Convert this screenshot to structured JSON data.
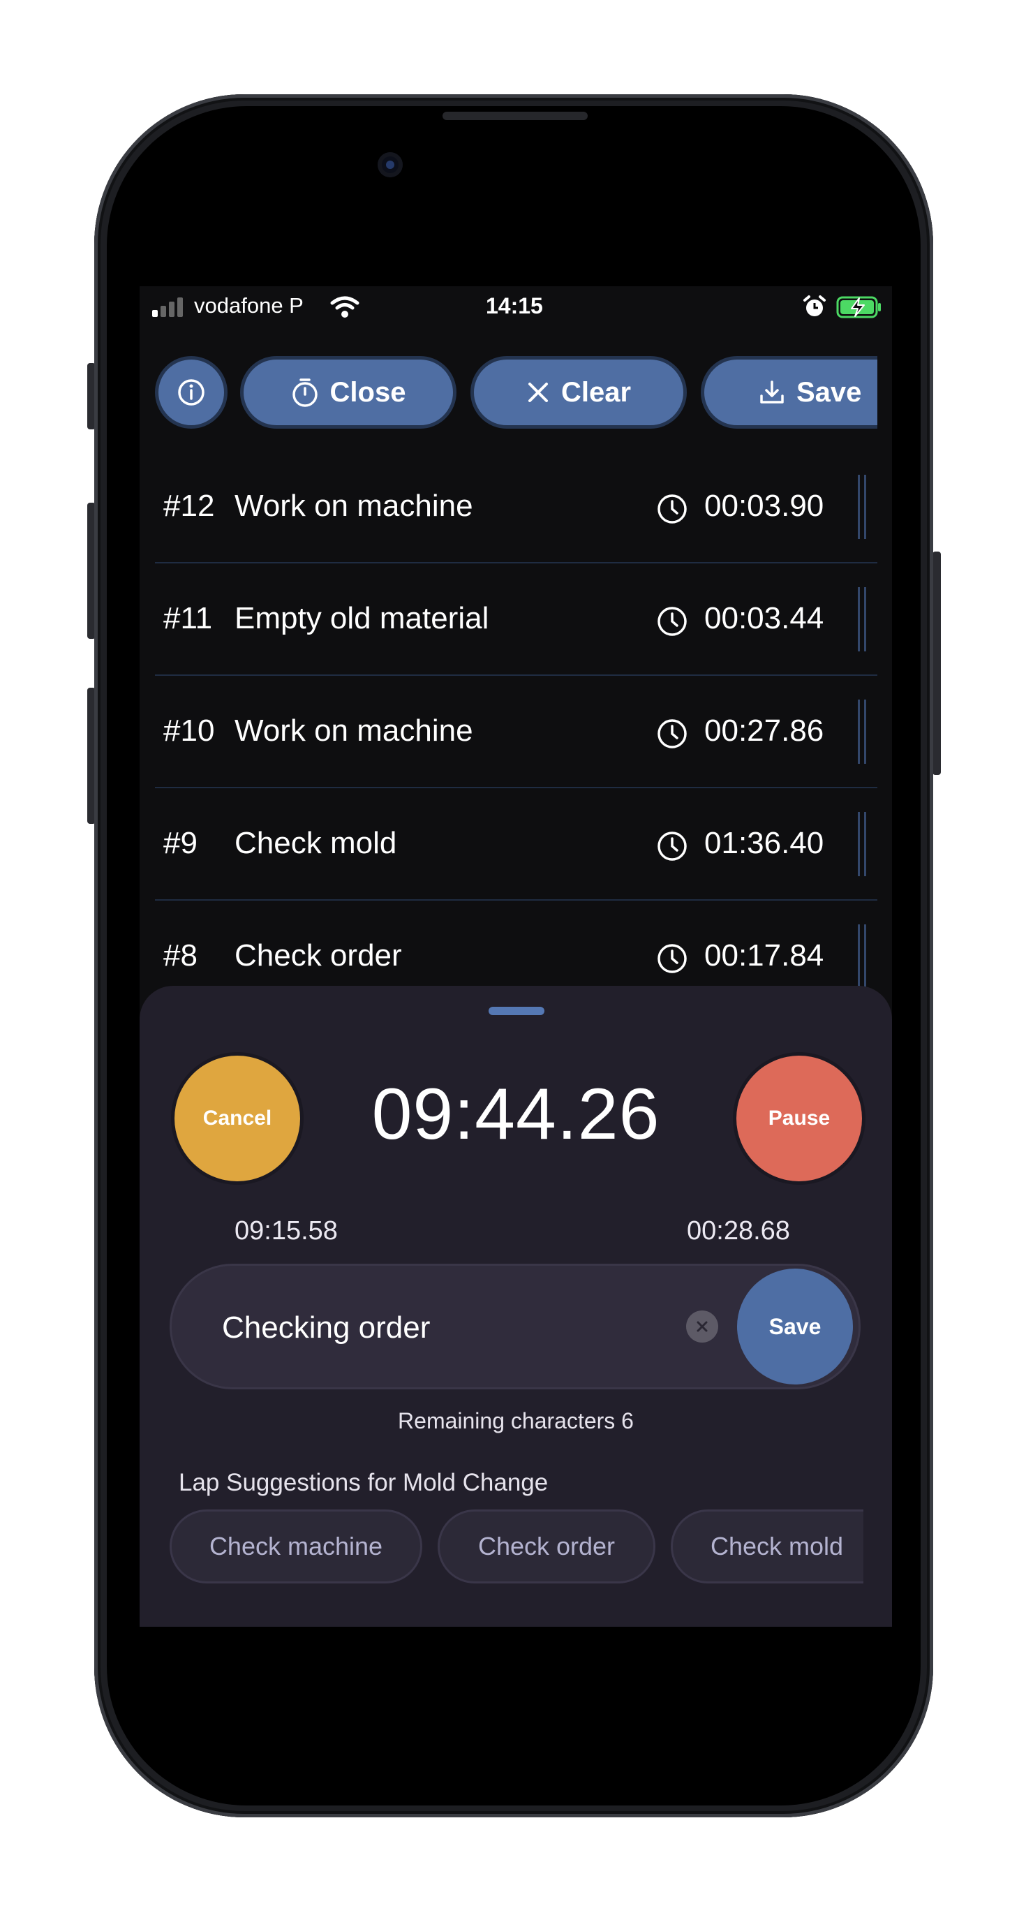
{
  "status_bar": {
    "carrier": "vodafone P",
    "time": "14:15",
    "signal_bars_filled": 1,
    "battery": "charging"
  },
  "toolbar": {
    "info_icon": "info-icon",
    "close_label": "Close",
    "clear_label": "Clear",
    "save_label": "Save"
  },
  "laps": [
    {
      "number": "#12",
      "name": "Work on machine",
      "time": "00:03.90"
    },
    {
      "number": "#11",
      "name": "Empty old material",
      "time": "00:03.44"
    },
    {
      "number": "#10",
      "name": "Work on machine",
      "time": "00:27.86"
    },
    {
      "number": "#9",
      "name": "Check mold",
      "time": "01:36.40"
    },
    {
      "number": "#8",
      "name": "Check order",
      "time": "00:17.84"
    }
  ],
  "timer": {
    "cancel_label": "Cancel",
    "pause_label": "Pause",
    "main_time": "09:44.26",
    "sub_left": "09:15.58",
    "sub_right": "00:28.68"
  },
  "lap_input": {
    "value": "Checking order",
    "save_label": "Save",
    "remaining": "Remaining characters 6"
  },
  "suggestions": {
    "title": "Lap Suggestions for Mold Change",
    "chips": [
      "Check machine",
      "Check order",
      "Check mold"
    ]
  },
  "colors": {
    "accent_blue": "#4f6ea3",
    "cancel_orange": "#dfa63f",
    "pause_red": "#dd6a59",
    "sheet_bg": "#221f2b",
    "screen_bg": "#0e0e10"
  }
}
